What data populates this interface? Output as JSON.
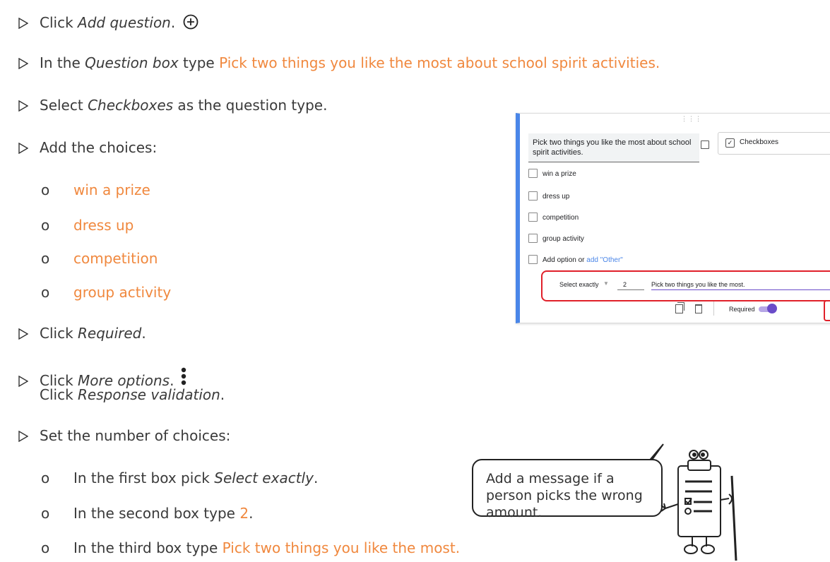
{
  "steps": [
    {
      "prefix": "Click ",
      "em": "Add question",
      "suffix": ".",
      "icon": "plus-circle-icon"
    },
    {
      "prefix": "In the ",
      "em": "Question box",
      "suffix": " type ",
      "orange": "Pick two things you like the most about school spirit activities."
    },
    {
      "prefix": "Select ",
      "em": "Checkboxes",
      "suffix": " as the question type."
    },
    {
      "text": "Add the choices:"
    },
    {
      "prefix": "Click ",
      "em": "Required",
      "suffix": "."
    },
    {
      "prefix": "Click ",
      "em": "More options",
      "suffix": ".",
      "icon": "more-vertical-icon"
    },
    {
      "text": "Set the number of choices:"
    }
  ],
  "steps_line6b": {
    "prefix": "Click ",
    "em": "Response validation",
    "suffix": "."
  },
  "choices": [
    "win a prize",
    "dress up",
    "competition",
    "group activity"
  ],
  "set_steps": [
    {
      "prefix": "In the first box pick ",
      "em": "Select exactly",
      "suffix": "."
    },
    {
      "prefix": "In the second box type ",
      "orange": "2",
      "suffix": "."
    },
    {
      "prefix": "In the third box type ",
      "orange": "Pick two things you like the most."
    }
  ],
  "bullet": "o",
  "form": {
    "question": "Pick two things you like the most about school spirit activities.",
    "type_label": "Checkboxes",
    "options": [
      "win a prize",
      "dress up",
      "competition",
      "group activity"
    ],
    "add_option": "Add option",
    "or": " or ",
    "add_other": "add \"Other\"",
    "validation_type": "Select exactly",
    "validation_number": "2",
    "validation_message": "Pick two things you like the most.",
    "required_label": "Required"
  },
  "bubble_text": "Add a message if a person picks the wrong amount.",
  "colors": {
    "highlight": "#f0883e",
    "accent": "#4a86e8",
    "toggle": "#6a4cc9",
    "callout": "#e0202a"
  }
}
